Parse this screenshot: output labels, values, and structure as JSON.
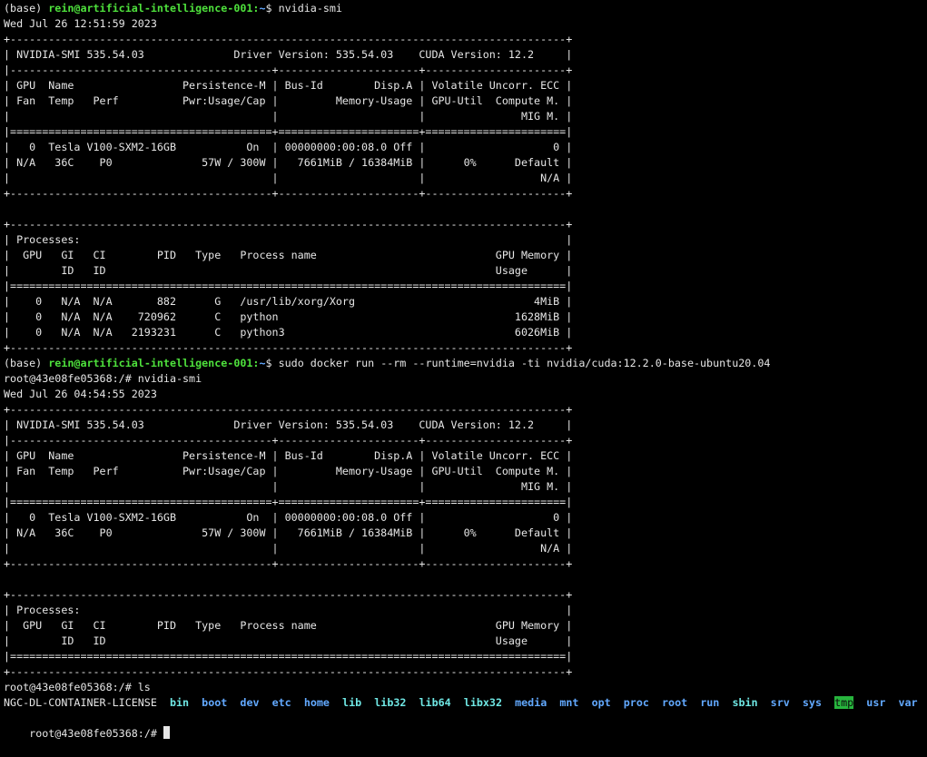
{
  "terminal": {
    "lines": [
      "(base) rein@artificial-intelligence-001:~$ nvidia-smi",
      "Wed Jul 26 12:51:59 2023",
      "+---------------------------------------------------------------------------------------+",
      "| NVIDIA-SMI 535.54.03              Driver Version: 535.54.03    CUDA Version: 12.2     |",
      "|-----------------------------------------+----------------------+----------------------+",
      "| GPU  Name                 Persistence-M | Bus-Id        Disp.A | Volatile Uncorr. ECC |",
      "| Fan  Temp   Perf          Pwr:Usage/Cap |         Memory-Usage | GPU-Util  Compute M. |",
      "|                                         |                      |               MIG M. |",
      "|=========================================+======================+======================|",
      "|   0  Tesla V100-SXM2-16GB           On  | 00000000:00:08.0 Off |                    0 |",
      "| N/A   36C    P0              57W / 300W |   7661MiB / 16384MiB |      0%      Default |",
      "|                                         |                      |                  N/A |",
      "+-----------------------------------------+----------------------+----------------------+",
      "",
      "+---------------------------------------------------------------------------------------+",
      "| Processes:                                                                            |",
      "|  GPU   GI   CI        PID   Type   Process name                            GPU Memory |",
      "|        ID   ID                                                             Usage      |",
      "|=======================================================================================|",
      "|    0   N/A  N/A       882      G   /usr/lib/xorg/Xorg                            4MiB |",
      "|    0   N/A  N/A    720962      C   python                                     1628MiB |",
      "|    0   N/A  N/A   2193231      C   python3                                    6026MiB |",
      "+---------------------------------------------------------------------------------------+",
      "(base) rein@artificial-intelligence-001:~$ sudo docker run --rm --runtime=nvidia -ti nvidia/cuda:12.2.0-base-ubuntu20.04",
      "root@43e08fe05368:/# nvidia-smi",
      "Wed Jul 26 04:54:55 2023",
      "+---------------------------------------------------------------------------------------+",
      "| NVIDIA-SMI 535.54.03              Driver Version: 535.54.03    CUDA Version: 12.2     |",
      "|-----------------------------------------+----------------------+----------------------+",
      "| GPU  Name                 Persistence-M | Bus-Id        Disp.A | Volatile Uncorr. ECC |",
      "| Fan  Temp   Perf          Pwr:Usage/Cap |         Memory-Usage | GPU-Util  Compute M. |",
      "|                                         |                      |               MIG M. |",
      "|=========================================+======================+======================|",
      "|   0  Tesla V100-SXM2-16GB           On  | 00000000:00:08.0 Off |                    0 |",
      "| N/A   36C    P0              57W / 300W |   7661MiB / 16384MiB |      0%      Default |",
      "|                                         |                      |                  N/A |",
      "+-----------------------------------------+----------------------+----------------------+",
      "",
      "+---------------------------------------------------------------------------------------+",
      "| Processes:                                                                            |",
      "|  GPU   GI   CI        PID   Type   Process name                            GPU Memory |",
      "|        ID   ID                                                             Usage      |",
      "|=======================================================================================|",
      "+---------------------------------------------------------------------------------------+",
      "root@43e08fe05368:/# ls"
    ],
    "host_prompt": {
      "prefix": "(base) ",
      "user_host": "rein@artificial-intelligence-001:",
      "path": "~",
      "suffix": "$ "
    },
    "commands": {
      "host_1": "nvidia-smi",
      "host_2": "sudo docker run --rm --runtime=nvidia -ti nvidia/cuda:12.2.0-base-ubuntu20.04"
    },
    "ls_output": [
      {
        "name": "NGC-DL-CONTAINER-LICENSE",
        "style": "plain"
      },
      {
        "name": "bin",
        "style": "cyan"
      },
      {
        "name": "boot",
        "style": "blue"
      },
      {
        "name": "dev",
        "style": "blue"
      },
      {
        "name": "etc",
        "style": "blue"
      },
      {
        "name": "home",
        "style": "blue"
      },
      {
        "name": "lib",
        "style": "cyan"
      },
      {
        "name": "lib32",
        "style": "cyan"
      },
      {
        "name": "lib64",
        "style": "cyan"
      },
      {
        "name": "libx32",
        "style": "cyan"
      },
      {
        "name": "media",
        "style": "blue"
      },
      {
        "name": "mnt",
        "style": "blue"
      },
      {
        "name": "opt",
        "style": "blue"
      },
      {
        "name": "proc",
        "style": "blue"
      },
      {
        "name": "root",
        "style": "blue"
      },
      {
        "name": "run",
        "style": "blue"
      },
      {
        "name": "sbin",
        "style": "cyan"
      },
      {
        "name": "srv",
        "style": "blue"
      },
      {
        "name": "sys",
        "style": "blue"
      },
      {
        "name": "tmp",
        "style": "tmp"
      },
      {
        "name": "usr",
        "style": "blue"
      },
      {
        "name": "var",
        "style": "blue"
      }
    ],
    "final_prompt": "root@43e08fe05368:/# ",
    "colors": {
      "background": "#000000",
      "text": "#e6e6e6",
      "user_host": "#4ee13c",
      "dir": "#62a9ff",
      "link": "#6fe7e4",
      "tmp_bg": "#27b53d"
    }
  }
}
